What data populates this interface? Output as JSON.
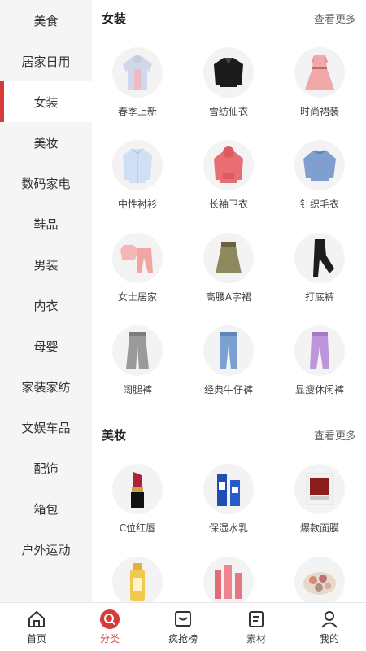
{
  "sidebar": {
    "items": [
      {
        "label": "美食",
        "active": false
      },
      {
        "label": "居家日用",
        "active": false
      },
      {
        "label": "女装",
        "active": true
      },
      {
        "label": "美妆",
        "active": false
      },
      {
        "label": "数码家电",
        "active": false
      },
      {
        "label": "鞋品",
        "active": false
      },
      {
        "label": "男装",
        "active": false
      },
      {
        "label": "内衣",
        "active": false
      },
      {
        "label": "母婴",
        "active": false
      },
      {
        "label": "家装家纺",
        "active": false
      },
      {
        "label": "文娱车品",
        "active": false
      },
      {
        "label": "配饰",
        "active": false
      },
      {
        "label": "箱包",
        "active": false
      },
      {
        "label": "户外运动",
        "active": false
      }
    ]
  },
  "sections": [
    {
      "title": "女装",
      "more": "查看更多",
      "items": [
        {
          "label": "春季上新",
          "icon": "hooded-jacket-icon"
        },
        {
          "label": "雪纺仙衣",
          "icon": "chiffon-blouse-icon"
        },
        {
          "label": "时尚裙装",
          "icon": "dress-icon"
        },
        {
          "label": "中性衬衫",
          "icon": "shirt-icon"
        },
        {
          "label": "长袖卫衣",
          "icon": "hoodie-icon"
        },
        {
          "label": "针织毛衣",
          "icon": "sweater-icon"
        },
        {
          "label": "女士居家",
          "icon": "pajamas-icon"
        },
        {
          "label": "高腰A字裙",
          "icon": "a-line-skirt-icon"
        },
        {
          "label": "打底裤",
          "icon": "leggings-icon"
        },
        {
          "label": "阔腿裤",
          "icon": "wide-leg-pants-icon"
        },
        {
          "label": "经典牛仔裤",
          "icon": "jeans-icon"
        },
        {
          "label": "显瘦休闲裤",
          "icon": "casual-pants-icon"
        }
      ]
    },
    {
      "title": "美妆",
      "more": "查看更多",
      "items": [
        {
          "label": "C位红唇",
          "icon": "lipstick-icon"
        },
        {
          "label": "保湿水乳",
          "icon": "lotion-icon"
        },
        {
          "label": "爆款面膜",
          "icon": "face-mask-icon"
        },
        {
          "label": "",
          "icon": "sunscreen-icon"
        },
        {
          "label": "",
          "icon": "skincare-set-icon"
        },
        {
          "label": "",
          "icon": "eyeshadow-palette-icon"
        }
      ]
    }
  ],
  "tabbar": {
    "items": [
      {
        "label": "首页",
        "icon": "home-icon",
        "active": false
      },
      {
        "label": "分类",
        "icon": "search-icon",
        "active": true
      },
      {
        "label": "疯抢榜",
        "icon": "ranking-icon",
        "active": false
      },
      {
        "label": "素材",
        "icon": "material-icon",
        "active": false
      },
      {
        "label": "我的",
        "icon": "profile-icon",
        "active": false
      }
    ]
  },
  "colors": {
    "accent": "#d83a3a",
    "sidebar_bg": "#f5f5f5"
  }
}
